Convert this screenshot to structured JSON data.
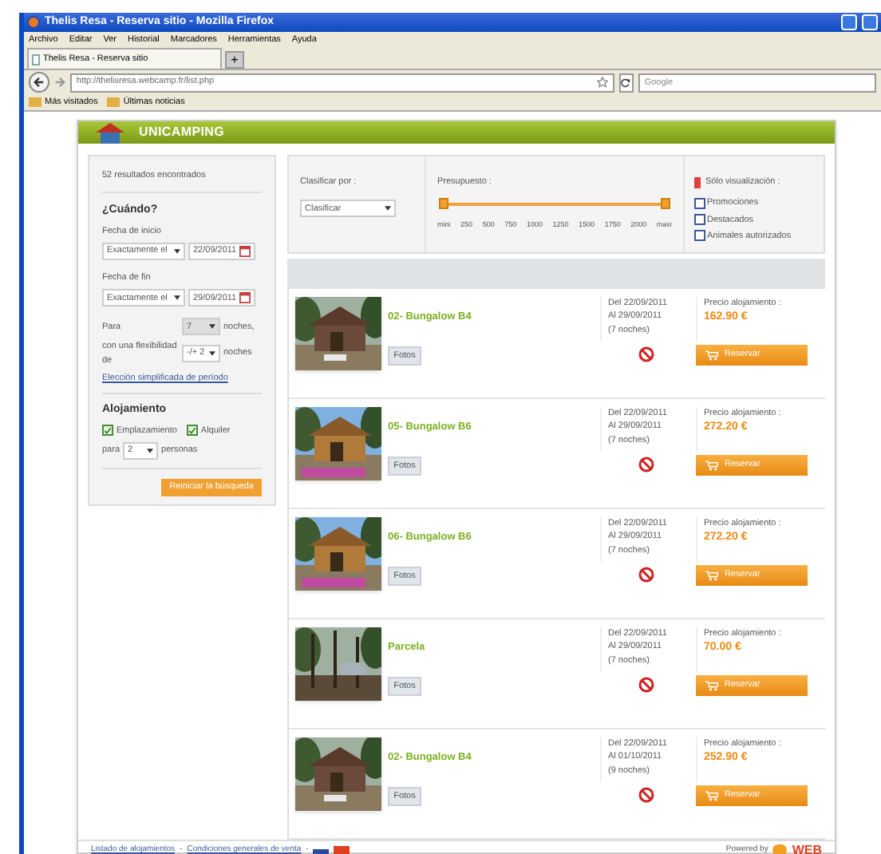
{
  "browser": {
    "title": "Thelis Resa - Reserva sitio - Mozilla Firefox",
    "menu": [
      "Archivo",
      "Editar",
      "Ver",
      "Historial",
      "Marcadores",
      "Herramientas",
      "Ayuda"
    ],
    "tab": "Thelis Resa - Reserva sitio",
    "new_tab": "+",
    "url": "http://thelisresa.webcamp.fr/list.php",
    "search_placeholder": "Google",
    "bookmarks": [
      "Más visitados",
      "Últimas noticias"
    ]
  },
  "header": {
    "brand": "UNICAMPING"
  },
  "sidebar": {
    "results": "52 resultados encontrados",
    "when": "¿Cuándo?",
    "start_label": "Fecha de inicio",
    "start_mode": "Exactamente el",
    "start_date": "22/09/2011",
    "end_label": "Fecha de fin",
    "end_mode": "Exactamente el",
    "end_date": "29/09/2011",
    "nights_label": "Para",
    "nights": "7",
    "nights_unit": "noches,",
    "flex_label": "con una flexibilidad de",
    "flex": "-/+ 2",
    "flex_unit": "noches",
    "period_link": "Elección simplificada de período",
    "accommodation": "Alojamiento",
    "types": [
      {
        "label": "Emplazamiento",
        "checked": true
      },
      {
        "label": "Alquiler",
        "checked": true
      }
    ],
    "persons_label": "para",
    "persons": "2",
    "persons_unit": "personas",
    "reset": "Reiniciar la búsqueda"
  },
  "filters": {
    "sort_label": "Clasificar por :",
    "sort": "Clasificar",
    "budget_label": "Presupuesto :",
    "ticks": [
      "mini",
      "250",
      "500",
      "750",
      "1000",
      "1250",
      "1500",
      "1750",
      "2000",
      "maxi"
    ],
    "budget_low": {
      "level": 0
    },
    "budget_high": {
      "level": 1
    },
    "only_label": "Sólo visualización :",
    "options": [
      {
        "label": "Promociones",
        "checked": false
      },
      {
        "label": "Destacados",
        "checked": false
      },
      {
        "label": "Animales autorizados",
        "checked": false
      }
    ]
  },
  "results": [
    {
      "name": "02- Bungalow B4",
      "photos": "Fotos",
      "from": "Del 22/09/2011",
      "to": "Al 29/09/2011",
      "nights": "(7 noches)",
      "price_label": "Precio alojamiento :",
      "price": "162.90 €",
      "book": "Reservar",
      "kind": "cabin"
    },
    {
      "name": "05- Bungalow B6",
      "photos": "Fotos",
      "from": "Del 22/09/2011",
      "to": "Al 29/09/2011",
      "nights": "(7 noches)",
      "price_label": "Precio alojamiento :",
      "price": "272.20 €",
      "book": "Reservar",
      "kind": "chalet"
    },
    {
      "name": "06- Bungalow B6",
      "photos": "Fotos",
      "from": "Del 22/09/2011",
      "to": "Al 29/09/2011",
      "nights": "(7 noches)",
      "price_label": "Precio alojamiento :",
      "price": "272.20 €",
      "book": "Reservar",
      "kind": "chalet"
    },
    {
      "name": "Parcela",
      "photos": "Fotos",
      "from": "Del 22/09/2011",
      "to": "Al 29/09/2011",
      "nights": "(7 noches)",
      "price_label": "Precio alojamiento :",
      "price": "70.00 €",
      "book": "Reservar",
      "kind": "forest"
    },
    {
      "name": "02- Bungalow B4",
      "photos": "Fotos",
      "from": "Del 22/09/2011",
      "to": "Al 01/10/2011",
      "nights": "(9 noches)",
      "price_label": "Precio alojamiento :",
      "price": "252.90 €",
      "book": "Reservar",
      "kind": "cabin"
    }
  ],
  "footer": {
    "links": [
      "Listado de alojamientos",
      "Condiciones generales de venta"
    ],
    "separator": "-",
    "powered": "Powered by",
    "logo": "WEB"
  }
}
